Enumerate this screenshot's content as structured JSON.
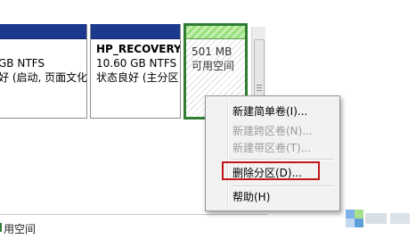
{
  "partitions": [
    {
      "name": "",
      "size": "GB NTFS",
      "status": "好 (启动, 页面文化"
    },
    {
      "name": "HP_RECOVERY",
      "size": "10.60 GB NTFS",
      "status": "状态良好 (主分区"
    },
    {
      "name": "",
      "size": "501 MB",
      "status": "可用空间"
    }
  ],
  "legend": {
    "label": "用空间"
  },
  "context_menu": {
    "items": [
      {
        "label": "新建简单卷(I)...",
        "enabled": true
      },
      {
        "label": "新建跨区卷(N)...",
        "enabled": false
      },
      {
        "label": "新建带区卷(T)...",
        "enabled": false
      },
      {
        "label": "删除分区(D)...",
        "enabled": true,
        "highlighted": true
      },
      {
        "label": "帮助(H)",
        "enabled": true
      }
    ]
  },
  "colors": {
    "partition_bar": "#1b3a8e",
    "free_space_selected_border": "#2f7d32",
    "highlight_box": "#c0181b"
  }
}
